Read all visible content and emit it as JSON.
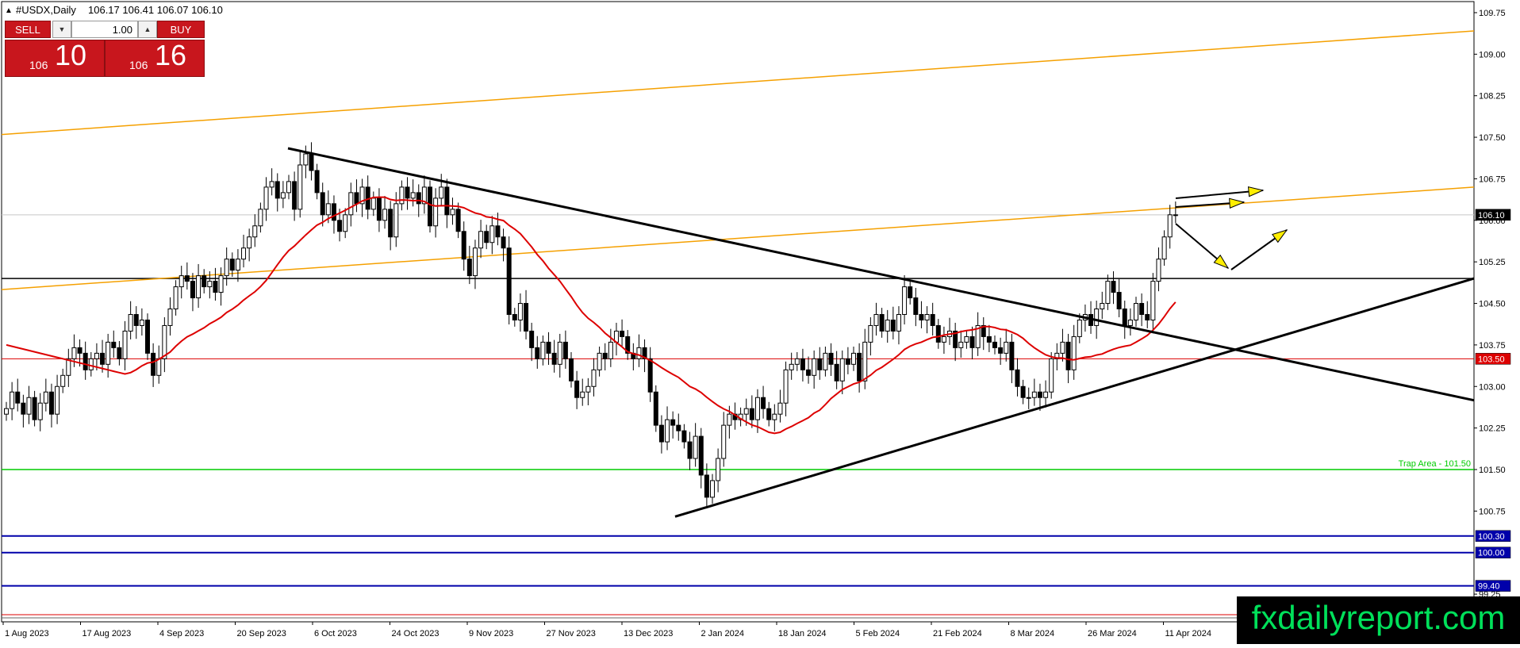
{
  "header": {
    "symbol": "#USDX,Daily",
    "ohlc": "106.17 106.41 106.07 106.10"
  },
  "trade_panel": {
    "sell_label": "SELL",
    "buy_label": "BUY",
    "lot_value": "1.00",
    "sell_small": "106",
    "sell_big": "10",
    "buy_small": "106",
    "buy_big": "16"
  },
  "brand": "fxdailyreport.com",
  "colors": {
    "bull": "#ffffff",
    "bear": "#000000",
    "ma": "#dd0000",
    "channel": "#f5a000",
    "trend": "#000000",
    "trap": "#00cc00",
    "support": "#0000aa",
    "arrow_fill": "#ffee00"
  },
  "chart_data": {
    "type": "candlestick",
    "ylim": [
      98.75,
      109.95
    ],
    "y_ticks": [
      "109.75",
      "109.00",
      "108.25",
      "107.50",
      "106.75",
      "106.00",
      "105.25",
      "104.50",
      "103.75",
      "103.00",
      "102.25",
      "101.50",
      "100.75",
      "99.25"
    ],
    "x_ticks": [
      "1 Aug 2023",
      "17 Aug 2023",
      "4 Sep 2023",
      "20 Sep 2023",
      "6 Oct 2023",
      "24 Oct 2023",
      "9 Nov 2023",
      "27 Nov 2023",
      "13 Dec 2023",
      "2 Jan 2024",
      "18 Jan 2024",
      "5 Feb 2024",
      "21 Feb 2024",
      "8 Mar 2024",
      "26 Mar 2024",
      "11 Apr 2024"
    ],
    "current_price": "106.10",
    "price_tags": [
      {
        "value": 103.5,
        "label": "103.50",
        "color": "#dd0000"
      },
      {
        "value": 100.3,
        "label": "100.30",
        "color": "#0000aa"
      },
      {
        "value": 100.0,
        "label": "100.00",
        "color": "#0000aa"
      },
      {
        "value": 99.4,
        "label": "99.40",
        "color": "#0000aa"
      }
    ],
    "horizontal_lines": [
      {
        "value": 104.95,
        "color": "#000000"
      },
      {
        "value": 101.5,
        "color": "#00cc00",
        "label": "Trap Area - 101.50"
      }
    ],
    "series": [
      {
        "name": "",
        "values": [
          102.6,
          102.9,
          102.7,
          102.5,
          102.8,
          102.4,
          102.7,
          102.9,
          102.5,
          103.0,
          103.2,
          103.5,
          103.7,
          103.6,
          103.3,
          103.5,
          103.6,
          103.4,
          103.8,
          103.7,
          103.5,
          104.0,
          104.3,
          104.1,
          104.2,
          103.6,
          103.2,
          103.5,
          104.1,
          104.4,
          104.8,
          105.0,
          104.9,
          104.6,
          105.0,
          104.8,
          104.9,
          104.7,
          105.0,
          105.3,
          105.1,
          105.3,
          105.5,
          105.7,
          105.9,
          106.2,
          106.6,
          106.7,
          106.4,
          106.5,
          106.7,
          106.2,
          107.0,
          107.2,
          106.9,
          106.5,
          106.1,
          106.3,
          106.0,
          105.8,
          106.1,
          106.5,
          106.3,
          106.6,
          106.2,
          106.4,
          106.0,
          106.2,
          105.7,
          106.3,
          106.6,
          106.4,
          106.5,
          106.3,
          106.6,
          105.9,
          106.4,
          106.6,
          106.1,
          106.2,
          105.8,
          105.3,
          105.0,
          105.5,
          105.8,
          105.6,
          105.9,
          105.7,
          105.5,
          104.3,
          104.2,
          104.5,
          104.0,
          103.7,
          103.5,
          103.8,
          103.6,
          103.4,
          103.8,
          103.5,
          103.1,
          102.8,
          102.9,
          103.0,
          103.3,
          103.6,
          103.5,
          103.8,
          104.0,
          103.9,
          103.6,
          103.5,
          103.7,
          103.5,
          102.9,
          102.3,
          102.0,
          102.4,
          102.3,
          102.2,
          102.0,
          101.7,
          102.1,
          101.4,
          101.0,
          101.3,
          101.7,
          102.3,
          102.5,
          102.4,
          102.5,
          102.6,
          102.4,
          102.8,
          102.6,
          102.4,
          102.5,
          102.7,
          103.3,
          103.4,
          103.5,
          103.3,
          103.2,
          103.5,
          103.3,
          103.6,
          103.4,
          103.1,
          103.5,
          103.4,
          103.6,
          103.1,
          103.8,
          104.1,
          104.3,
          104.0,
          104.2,
          104.0,
          104.3,
          104.8,
          104.6,
          104.3,
          104.2,
          104.3,
          104.1,
          103.8,
          103.9,
          104.0,
          103.7,
          103.8,
          103.9,
          103.7,
          104.1,
          103.9,
          103.8,
          103.7,
          103.6,
          103.8,
          103.3,
          103.0,
          102.8,
          102.8,
          102.9,
          102.8,
          102.9,
          103.5,
          103.6,
          103.8,
          103.3,
          103.9,
          104.2,
          104.3,
          104.1,
          104.4,
          104.5,
          104.9,
          104.7,
          104.4,
          104.1,
          104.2,
          104.5,
          104.3,
          104.2,
          104.9,
          105.3,
          105.7,
          106.1,
          106.1
        ]
      }
    ]
  }
}
